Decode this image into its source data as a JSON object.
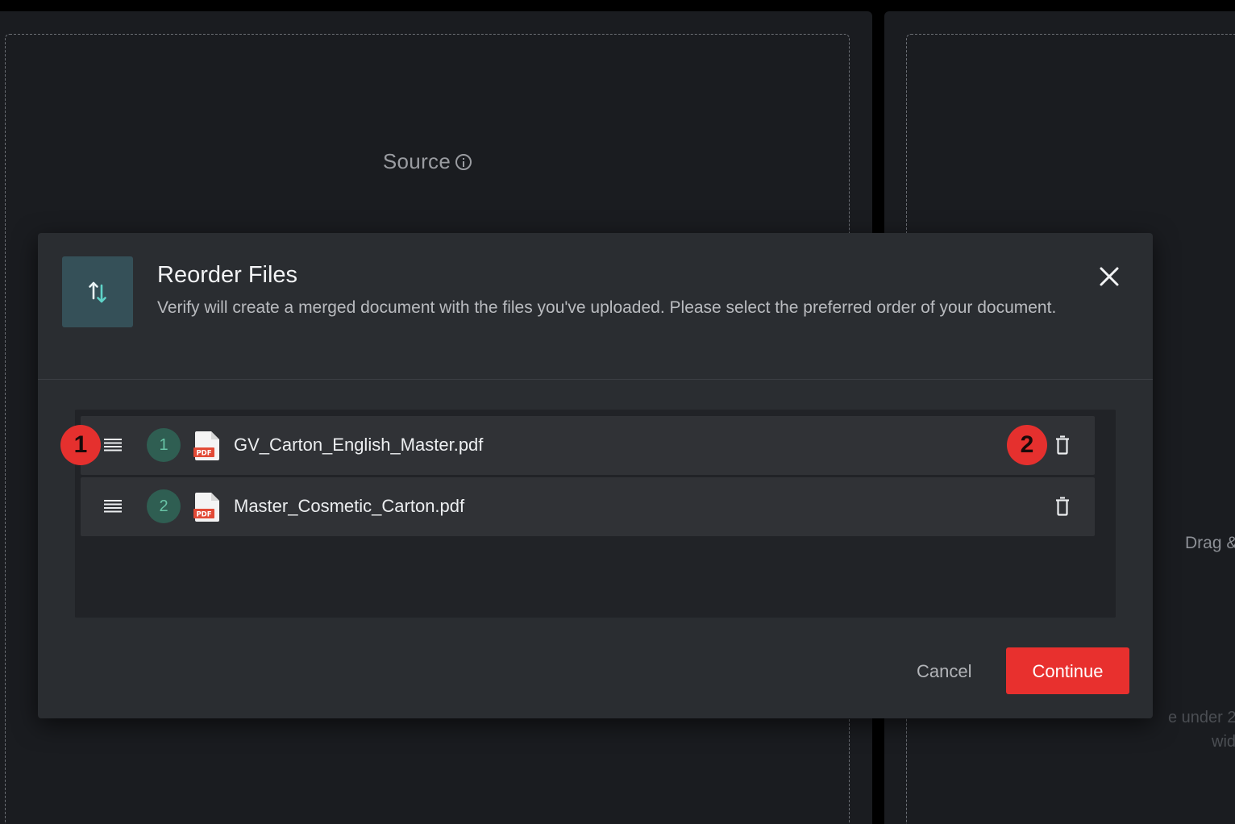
{
  "background": {
    "source_panel": {
      "title": "Source",
      "info_icon": "info-icon"
    },
    "target_panel": {
      "drag_text": "Drag & d",
      "hint_line_1": "e under 2",
      "hint_line_2": "width"
    }
  },
  "modal": {
    "icon": "reorder-arrows-icon",
    "title": "Reorder Files",
    "description": "Verify will create a merged document with the files you've uploaded. Please select the preferred order of your document.",
    "close_icon": "close-icon",
    "files": [
      {
        "order": "1",
        "name": "GV_Carton_English_Master.pdf",
        "type_label": "PDF"
      },
      {
        "order": "2",
        "name": "Master_Cosmetic_Carton.pdf",
        "type_label": "PDF"
      }
    ],
    "markers": [
      "1",
      "2"
    ],
    "cancel_label": "Cancel",
    "continue_label": "Continue"
  },
  "colors": {
    "accent": "#e8302e",
    "badge_bg": "#2f5e52",
    "badge_text": "#68c4a6",
    "modal_bg": "#2a2d31"
  }
}
